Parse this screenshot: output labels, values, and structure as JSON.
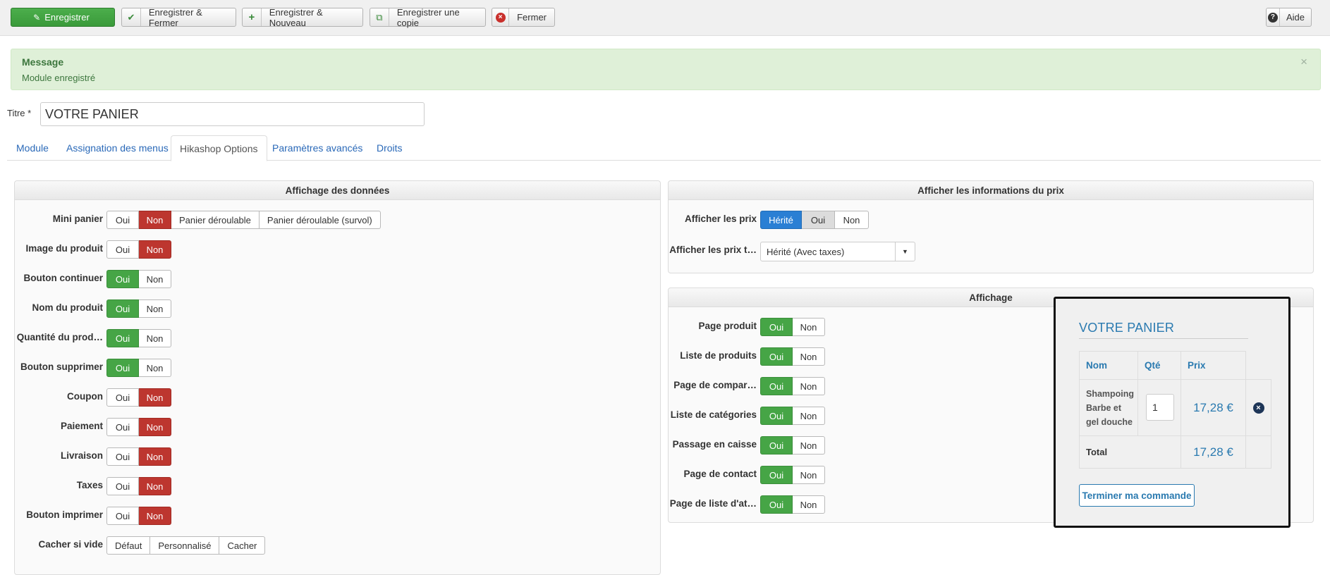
{
  "toolbar": {
    "save": "Enregistrer",
    "save_close": "Enregistrer & Fermer",
    "save_new": "Enregistrer & Nouveau",
    "save_copy": "Enregistrer une copie",
    "close": "Fermer",
    "help": "Aide"
  },
  "message": {
    "heading": "Message",
    "text": "Module enregistré",
    "close_glyph": "×"
  },
  "title": {
    "label": "Titre *",
    "value": "VOTRE PANIER"
  },
  "tabs": [
    "Module",
    "Assignation des menus",
    "Hikashop Options",
    "Paramètres avancés",
    "Droits"
  ],
  "active_tab": "Hikashop Options",
  "data_panel": {
    "heading": "Affichage des données",
    "rows": [
      {
        "label": "Mini panier",
        "options": [
          "Oui",
          "Non",
          "Panier déroulable",
          "Panier déroulable (survol)"
        ],
        "selected": "Non"
      },
      {
        "label": "Image du produit",
        "options": [
          "Oui",
          "Non"
        ],
        "selected": "Non"
      },
      {
        "label": "Bouton continuer",
        "options": [
          "Oui",
          "Non"
        ],
        "selected": "Oui"
      },
      {
        "label": "Nom du produit",
        "options": [
          "Oui",
          "Non"
        ],
        "selected": "Oui"
      },
      {
        "label": "Quantité du prod…",
        "options": [
          "Oui",
          "Non"
        ],
        "selected": "Oui"
      },
      {
        "label": "Bouton supprimer",
        "options": [
          "Oui",
          "Non"
        ],
        "selected": "Oui"
      },
      {
        "label": "Coupon",
        "options": [
          "Oui",
          "Non"
        ],
        "selected": "Non"
      },
      {
        "label": "Paiement",
        "options": [
          "Oui",
          "Non"
        ],
        "selected": "Non"
      },
      {
        "label": "Livraison",
        "options": [
          "Oui",
          "Non"
        ],
        "selected": "Non"
      },
      {
        "label": "Taxes",
        "options": [
          "Oui",
          "Non"
        ],
        "selected": "Non"
      },
      {
        "label": "Bouton imprimer",
        "options": [
          "Oui",
          "Non"
        ],
        "selected": "Non"
      },
      {
        "label": "Cacher si vide",
        "options": [
          "Défaut",
          "Personnalisé",
          "Cacher"
        ],
        "selected": ""
      }
    ]
  },
  "price_panel": {
    "heading": "Afficher les informations du prix",
    "show_prices": {
      "label": "Afficher les prix",
      "options": [
        "Hérité",
        "Oui",
        "Non"
      ],
      "selected": "Hérité"
    },
    "show_prices_t": {
      "label": "Afficher les prix t…",
      "value": "Hérité (Avec taxes)"
    }
  },
  "display_panel": {
    "heading": "Affichage",
    "rows": [
      {
        "label": "Page produit",
        "options": [
          "Oui",
          "Non"
        ],
        "selected": "Oui"
      },
      {
        "label": "Liste de produits",
        "options": [
          "Oui",
          "Non"
        ],
        "selected": "Oui"
      },
      {
        "label": "Page de compar…",
        "options": [
          "Oui",
          "Non"
        ],
        "selected": "Oui"
      },
      {
        "label": "Liste de catégories",
        "options": [
          "Oui",
          "Non"
        ],
        "selected": "Oui"
      },
      {
        "label": "Passage en caisse",
        "options": [
          "Oui",
          "Non"
        ],
        "selected": "Oui"
      },
      {
        "label": "Page de contact",
        "options": [
          "Oui",
          "Non"
        ],
        "selected": "Oui"
      },
      {
        "label": "Page de liste d'at…",
        "options": [
          "Oui",
          "Non"
        ],
        "selected": "Oui"
      }
    ]
  },
  "cart_preview": {
    "title": "VOTRE PANIER",
    "col_name": "Nom",
    "col_qty": "Qté",
    "col_price": "Prix",
    "item_name": "Shampoing Barbe et gel douche",
    "item_qty": "1",
    "item_price": "17,28 €",
    "total_label": "Total",
    "total_value": "17,28 €",
    "checkout": "Terminer ma commande"
  },
  "colors": {
    "primary_green": "#46a546",
    "danger_red": "#bd362f",
    "info_blue": "#2a7fd4",
    "link_blue": "#2a69b8",
    "alert_bg": "#dff0d8"
  }
}
